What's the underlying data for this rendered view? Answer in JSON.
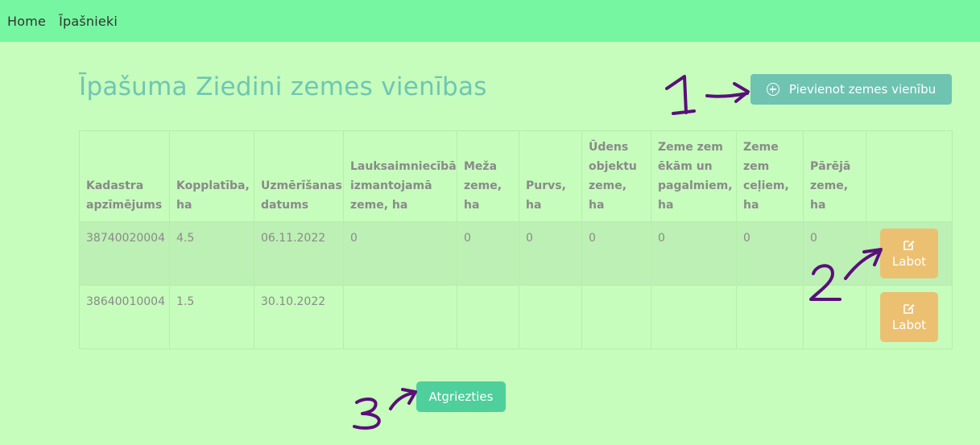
{
  "nav": {
    "home": "Home",
    "owners": "Īpašnieki"
  },
  "page": {
    "title": "Īpašuma Ziedini zemes vienības"
  },
  "actions": {
    "add_label": "Pievienot zemes vienību",
    "back_label": "Atgriezties"
  },
  "table": {
    "headers": [
      "Kadastra apzīmējums",
      "Kopplatība, ha",
      "Uzmērīšanas datums",
      "Lauksaimniecībā izmantojamā zeme, ha",
      "Meža zeme, ha",
      "Purvs, ha",
      "Ūdens objektu zeme, ha",
      "Zeme zem ēkām un pagalmiem, ha",
      "Zeme zem ceļiem, ha",
      "Pārējā zeme, ha"
    ],
    "rows": [
      {
        "cells": [
          "38740020004",
          "4.5",
          "06.11.2022",
          "0",
          "0",
          "0",
          "0",
          "0",
          "0",
          "0"
        ],
        "edit_label": "Labot"
      },
      {
        "cells": [
          "38640010004",
          "1.5",
          "30.10.2022",
          "",
          "",
          "",
          "",
          "",
          "",
          ""
        ],
        "edit_label": "Labot"
      }
    ]
  },
  "annotations": [
    "1",
    "2",
    "3"
  ],
  "colors": {
    "background": "#c6fcbc",
    "navbar": "#76f6a0",
    "title": "#6fc6b4",
    "add_button": "#6ec3b1",
    "edit_button": "#ecc071",
    "back_button": "#4ecf9b",
    "annotation_ink": "#5a0f7a"
  },
  "icons": {
    "add": "plus-circle-icon",
    "edit": "edit-icon"
  }
}
